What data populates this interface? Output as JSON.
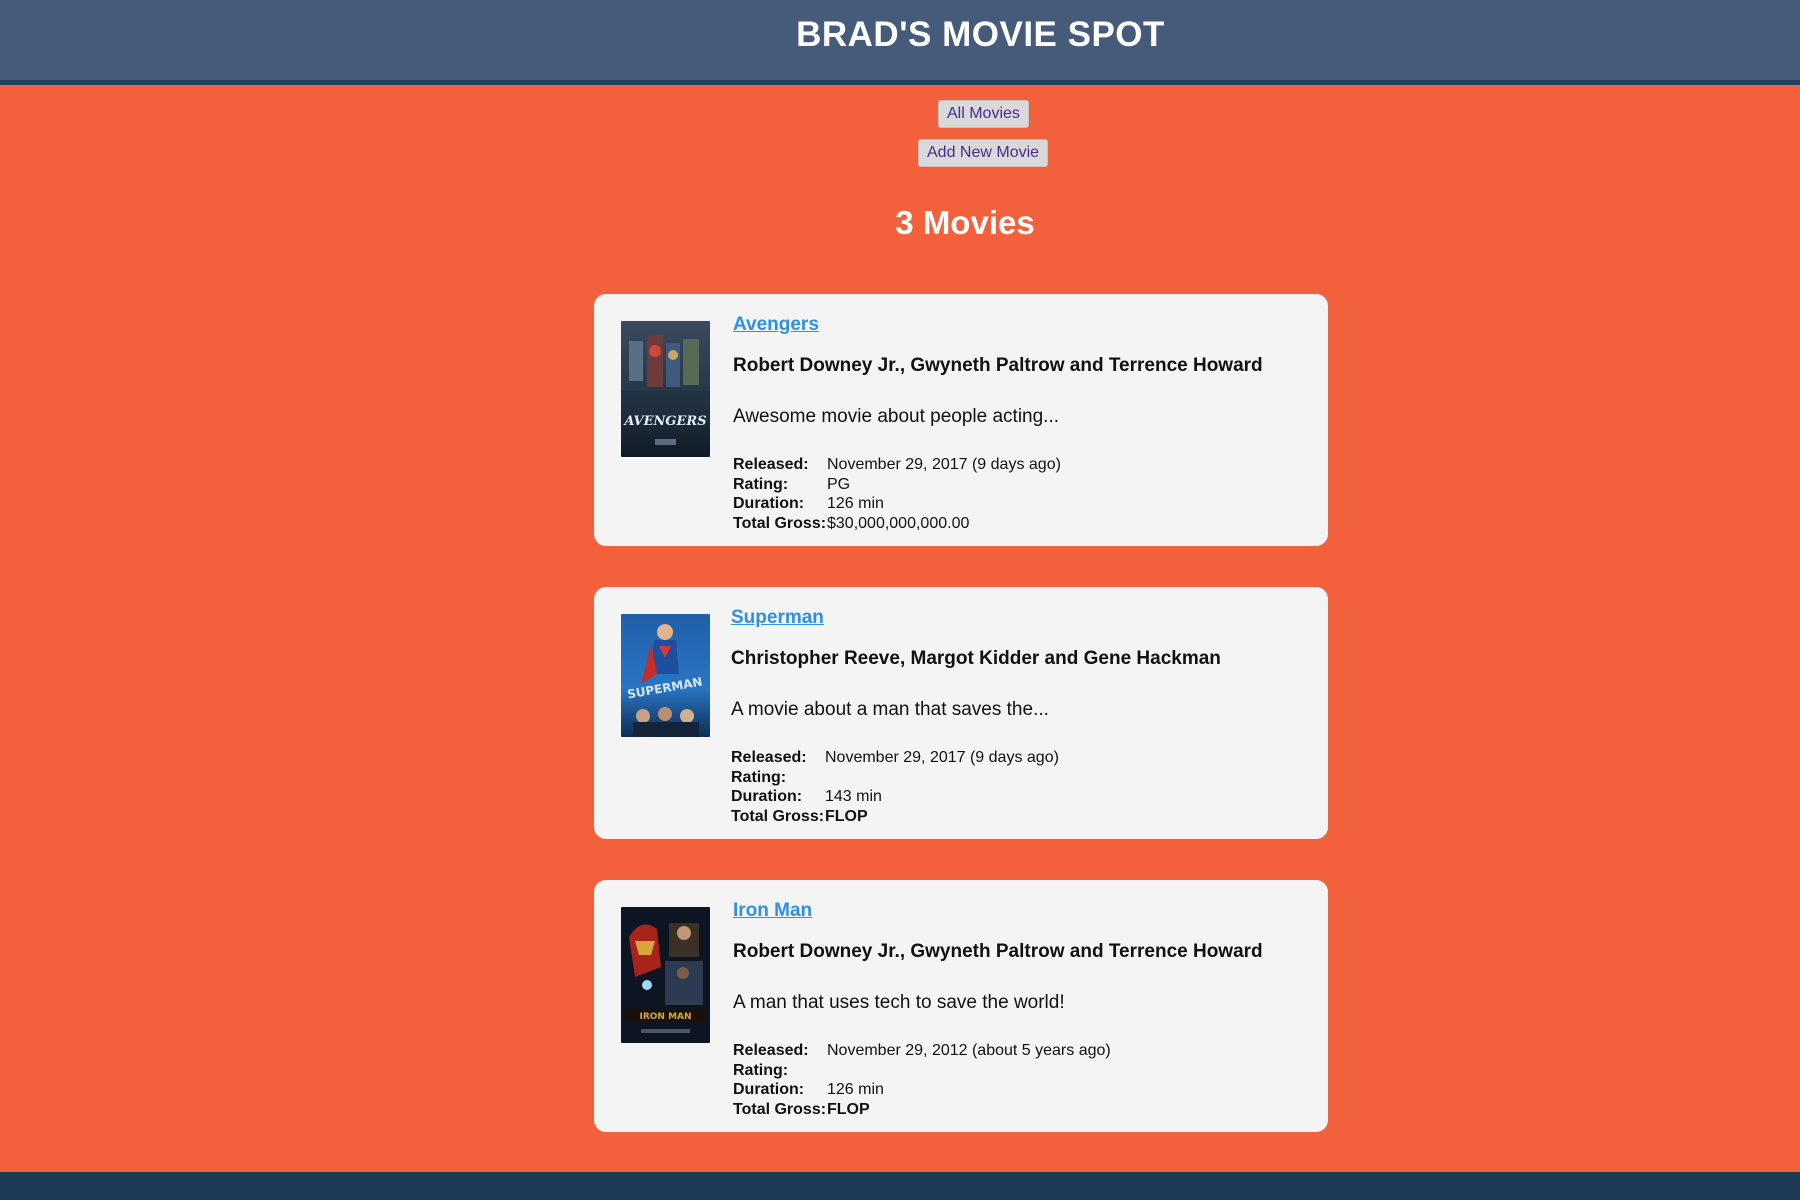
{
  "header": {
    "title": "BRAD'S MOVIE SPOT"
  },
  "nav": {
    "all_movies": "All Movies",
    "add_new_movie": "Add New Movie"
  },
  "count_heading": "3 Movies",
  "labels": {
    "released": "Released:",
    "rating": "Rating:",
    "duration": "Duration:",
    "total_gross": "Total Gross:"
  },
  "movies": [
    {
      "title": "Avengers",
      "cast": "Robert Downey Jr., Gwyneth Paltrow and Terrence Howard",
      "description": "Awesome movie about people acting...",
      "released": "November 29, 2017 (9 days ago)",
      "rating": "PG",
      "duration": "126 min",
      "total_gross": "$30,000,000,000.00",
      "poster_text": "AVENGERS"
    },
    {
      "title": "Superman",
      "cast": "Christopher Reeve, Margot Kidder and Gene Hackman",
      "description": "A movie about a man that saves the...",
      "released": "November 29, 2017 (9 days ago)",
      "rating": "",
      "duration": "143 min",
      "total_gross": "FLOP",
      "poster_text": "SUPERMAN"
    },
    {
      "title": "Iron Man",
      "cast": "Robert Downey Jr., Gwyneth Paltrow and Terrence Howard",
      "description": "A man that uses tech to save the world!",
      "released": "November 29, 2012 (about 5 years ago)",
      "rating": "",
      "duration": "126 min",
      "total_gross": "FLOP",
      "poster_text": "IRON MAN"
    }
  ]
}
